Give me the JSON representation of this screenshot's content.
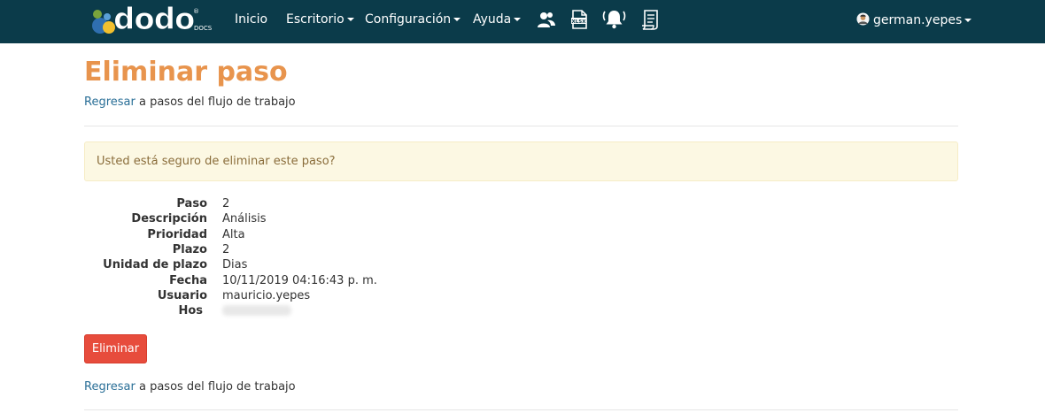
{
  "navbar": {
    "logo_text": "dodo",
    "logo_sub": "DOCS",
    "logo_reg": "®",
    "items": [
      {
        "label": "Inicio"
      },
      {
        "label": "Escritorio"
      },
      {
        "label": "Configuración"
      },
      {
        "label": "Ayuda"
      }
    ],
    "icons": [
      "users-icon",
      "xlsx-file-icon",
      "bell-icon",
      "document-icon"
    ],
    "user": "german.yepes"
  },
  "page": {
    "title": "Eliminar paso",
    "back_link": "Regresar",
    "back_text": "a pasos del flujo de trabajo",
    "alert": "Usted está seguro de eliminar este paso?",
    "details": [
      {
        "label": "Paso",
        "value": "2"
      },
      {
        "label": "Descripción",
        "value": "Análisis"
      },
      {
        "label": "Prioridad",
        "value": "Alta"
      },
      {
        "label": "Plazo",
        "value": "2"
      },
      {
        "label": "Unidad de plazo",
        "value": "Dias"
      },
      {
        "label": "Fecha",
        "value": "10/11/2019 04:16:43 p. m."
      },
      {
        "label": "Usuario",
        "value": "mauricio.yepes"
      },
      {
        "label": "Hos",
        "value": ""
      }
    ],
    "delete_button": "Eliminar"
  },
  "colors": {
    "navbar": "#0b3b4a",
    "title": "#e8944d",
    "link": "#2a6f97",
    "alert_bg": "#fcf8e3",
    "alert_text": "#8a6d3b",
    "danger": "#e74c3c"
  }
}
